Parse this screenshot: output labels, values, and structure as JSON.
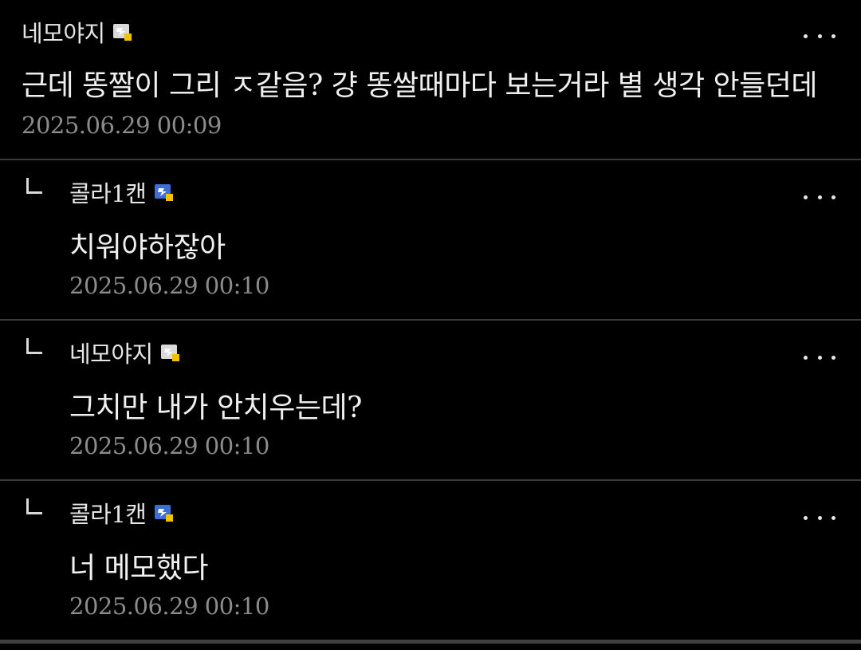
{
  "comments": [
    {
      "nickname": "네모야지",
      "badge": "gray-gallery-badge",
      "text": "근데 똥짤이 그리 ㅈ같음? 걍 똥쌀때마다 보는거라 별 생각 안들던데",
      "date": "2025.06.29 00:09",
      "more_icon": "more-dots-icon"
    },
    {
      "nickname": "콜라1캔",
      "badge": "blue-gallery-badge",
      "text": "치워야하잖아",
      "date": "2025.06.29 00:10",
      "reply_icon": "reply-corner-icon",
      "more_icon": "more-dots-icon"
    },
    {
      "nickname": "네모야지",
      "badge": "gray-gallery-badge",
      "text": "그치만 내가 안치우는데?",
      "date": "2025.06.29 00:10",
      "reply_icon": "reply-corner-icon",
      "more_icon": "more-dots-icon"
    },
    {
      "nickname": "콜라1캔",
      "badge": "blue-gallery-badge",
      "text": "너 메모했다",
      "date": "2025.06.29 00:10",
      "reply_icon": "reply-corner-icon",
      "more_icon": "more-dots-icon"
    }
  ],
  "colors": {
    "background": "#000000",
    "divider": "#3a3a3a",
    "text": "#f0f0f0",
    "date": "#8c8c8c",
    "badge_gray": "#d9d9d9",
    "badge_blue": "#3b6fd6",
    "badge_yellow": "#f2c200"
  }
}
